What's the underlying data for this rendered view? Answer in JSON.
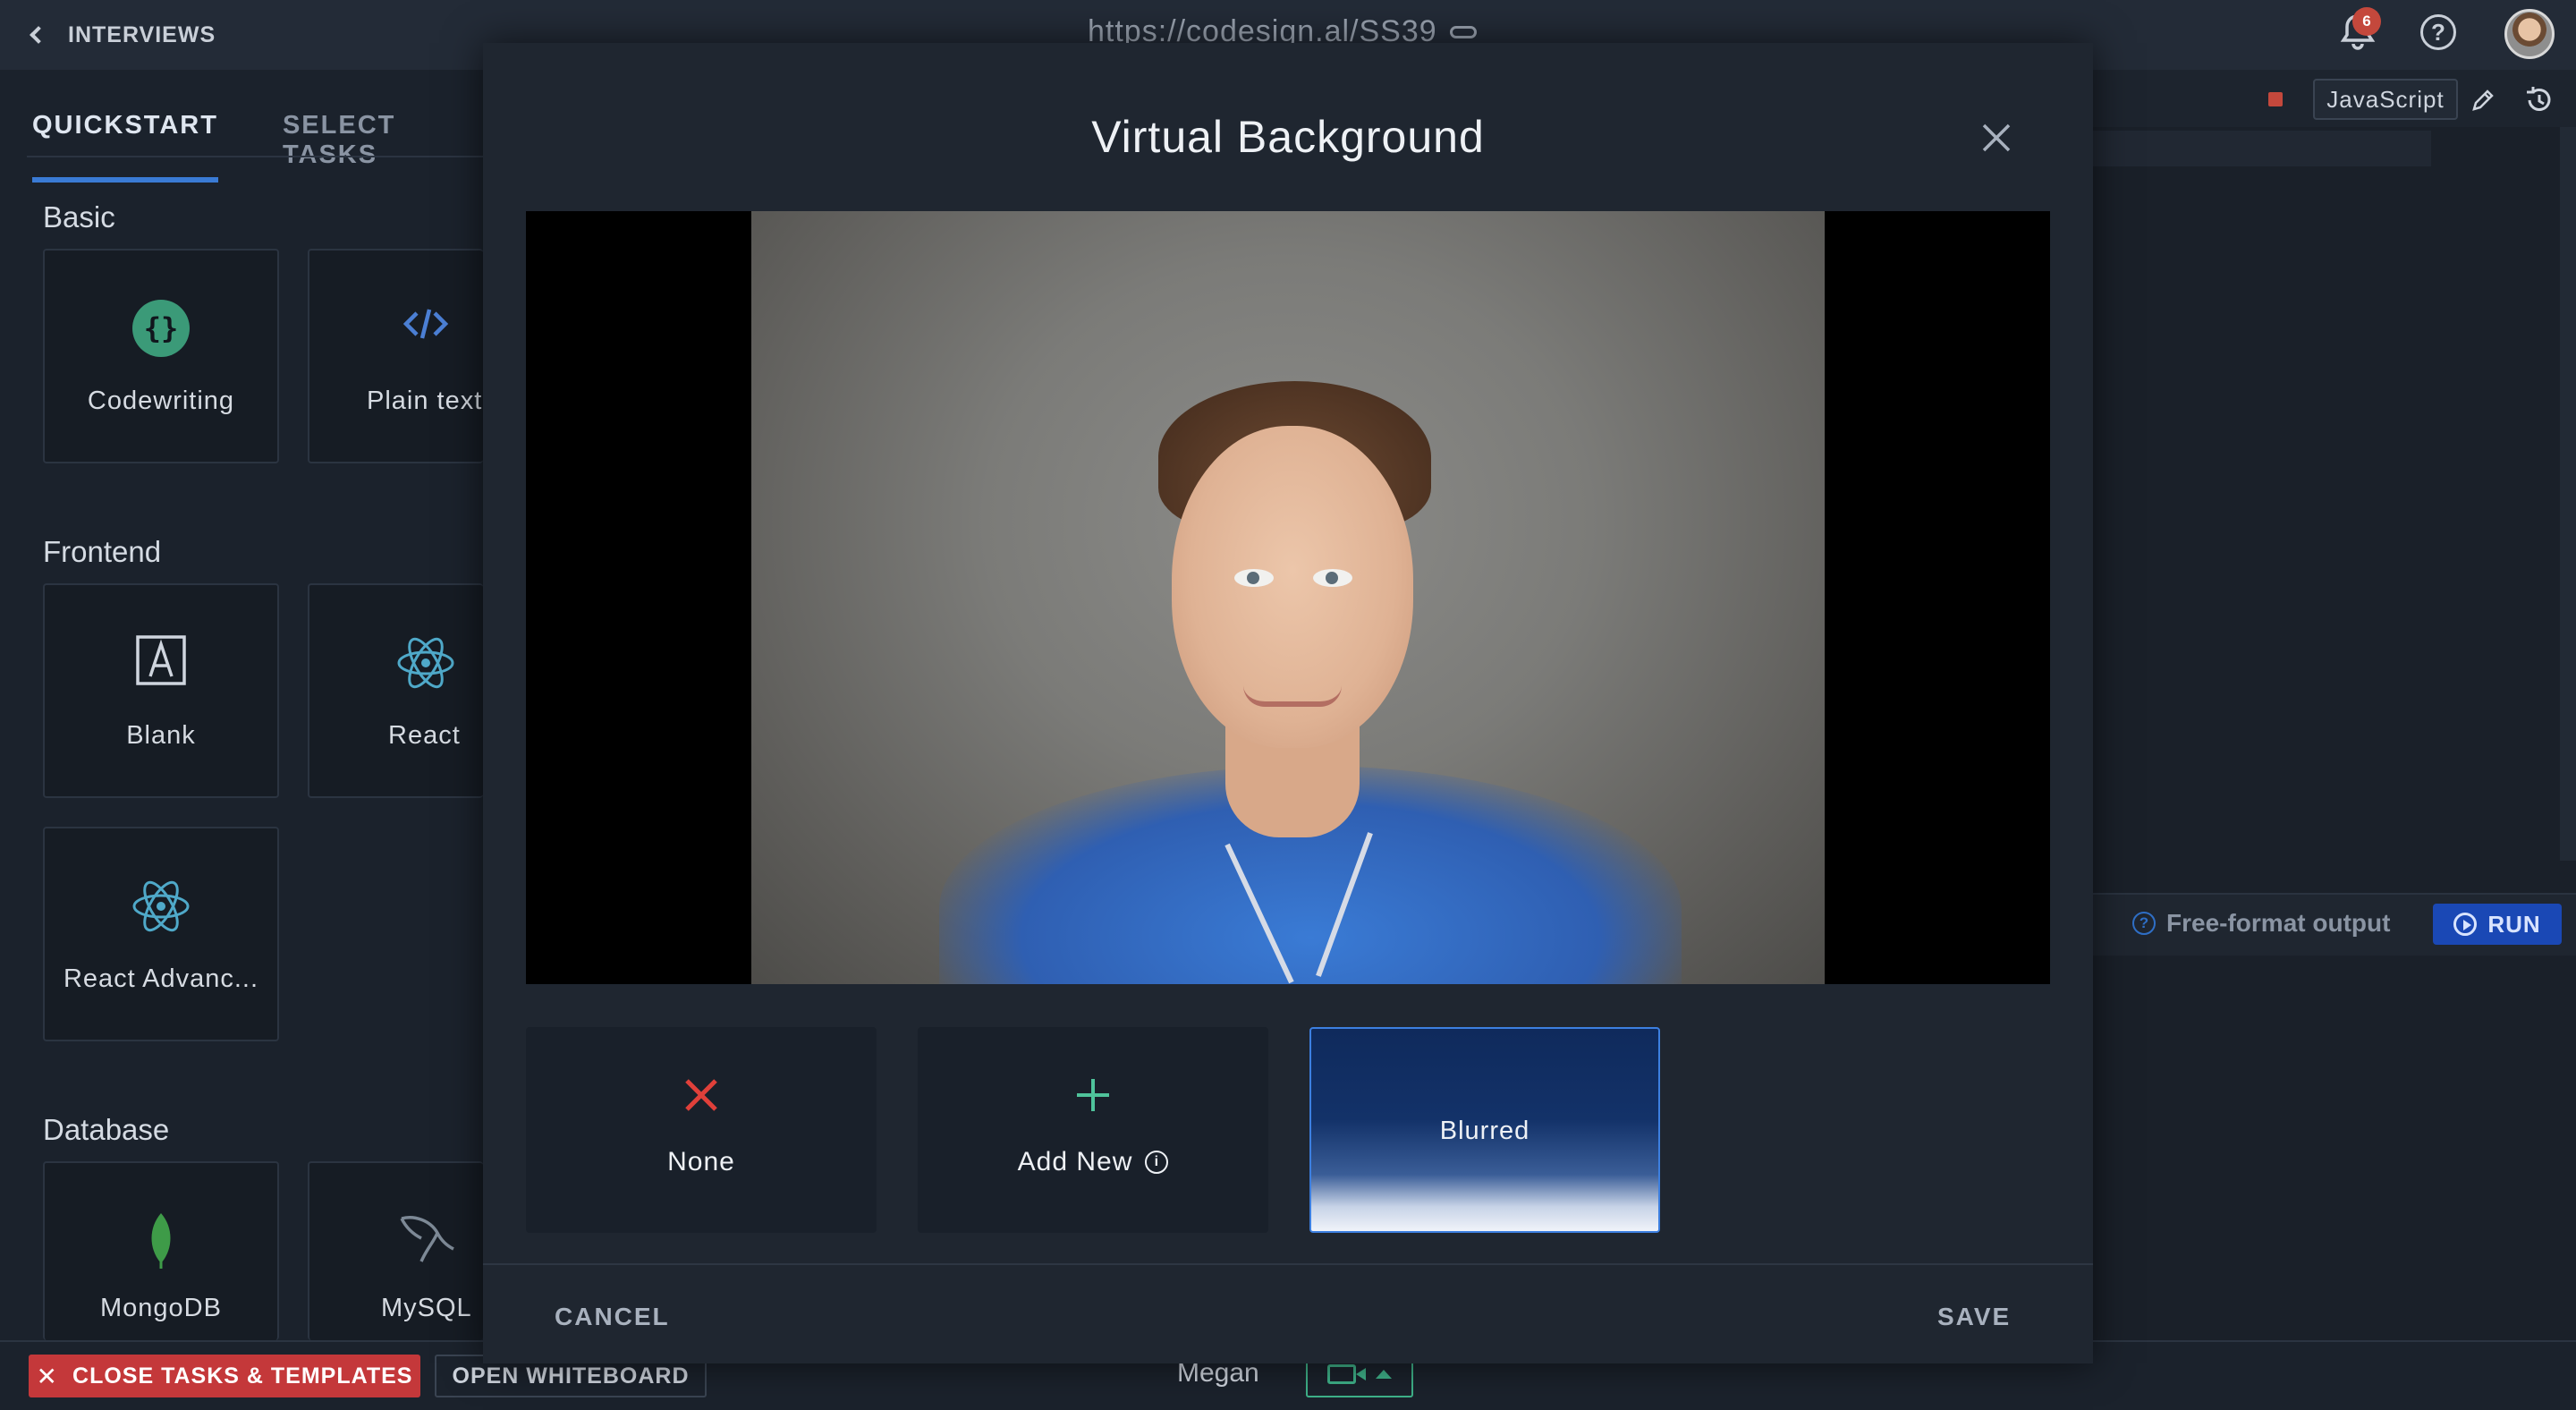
{
  "header": {
    "back_label": "INTERVIEWS",
    "url": "https://codesign.al/SS39",
    "notification_count": "6",
    "help_icon": "question-circle-icon"
  },
  "left_panel": {
    "tabs": [
      {
        "label": "QUICKSTART",
        "active": true
      },
      {
        "label": "SELECT TASKS",
        "active": false
      }
    ],
    "sections": [
      {
        "title": "Basic",
        "items": [
          {
            "label": "Codewriting",
            "icon": "braces-icon"
          },
          {
            "label": "Plain text",
            "icon": "code-tag-icon"
          }
        ]
      },
      {
        "title": "Frontend",
        "items": [
          {
            "label": "Blank",
            "icon": "letter-a-box-icon"
          },
          {
            "label": "React",
            "icon": "react-atom-icon"
          },
          {
            "label": "React Advanc...",
            "icon": "react-atom-icon"
          }
        ]
      },
      {
        "title": "Database",
        "items": [
          {
            "label": "MongoDB",
            "icon": "mongodb-leaf-icon"
          },
          {
            "label": "MySQL",
            "icon": "mysql-dolphin-icon"
          }
        ]
      }
    ]
  },
  "editor": {
    "language": "JavaScript",
    "output_label": "Free-format output",
    "run_label": "RUN"
  },
  "footer": {
    "close_label": "CLOSE TASKS & TEMPLATES",
    "whiteboard_label": "OPEN WHITEBOARD",
    "participant_name": "Megan"
  },
  "modal": {
    "title": "Virtual Background",
    "options": [
      {
        "label": "None",
        "icon": "red-x-icon"
      },
      {
        "label": "Add New",
        "icon": "plus-icon",
        "info_icon": "info-circle-icon"
      },
      {
        "label": "Blurred",
        "selected": true
      }
    ],
    "cancel_label": "CANCEL",
    "save_label": "SAVE"
  },
  "colors": {
    "accent_blue": "#3a7bd5",
    "danger_red": "#c4383a",
    "camera_green": "#3fb38a",
    "run_blue": "#1a48b5"
  }
}
